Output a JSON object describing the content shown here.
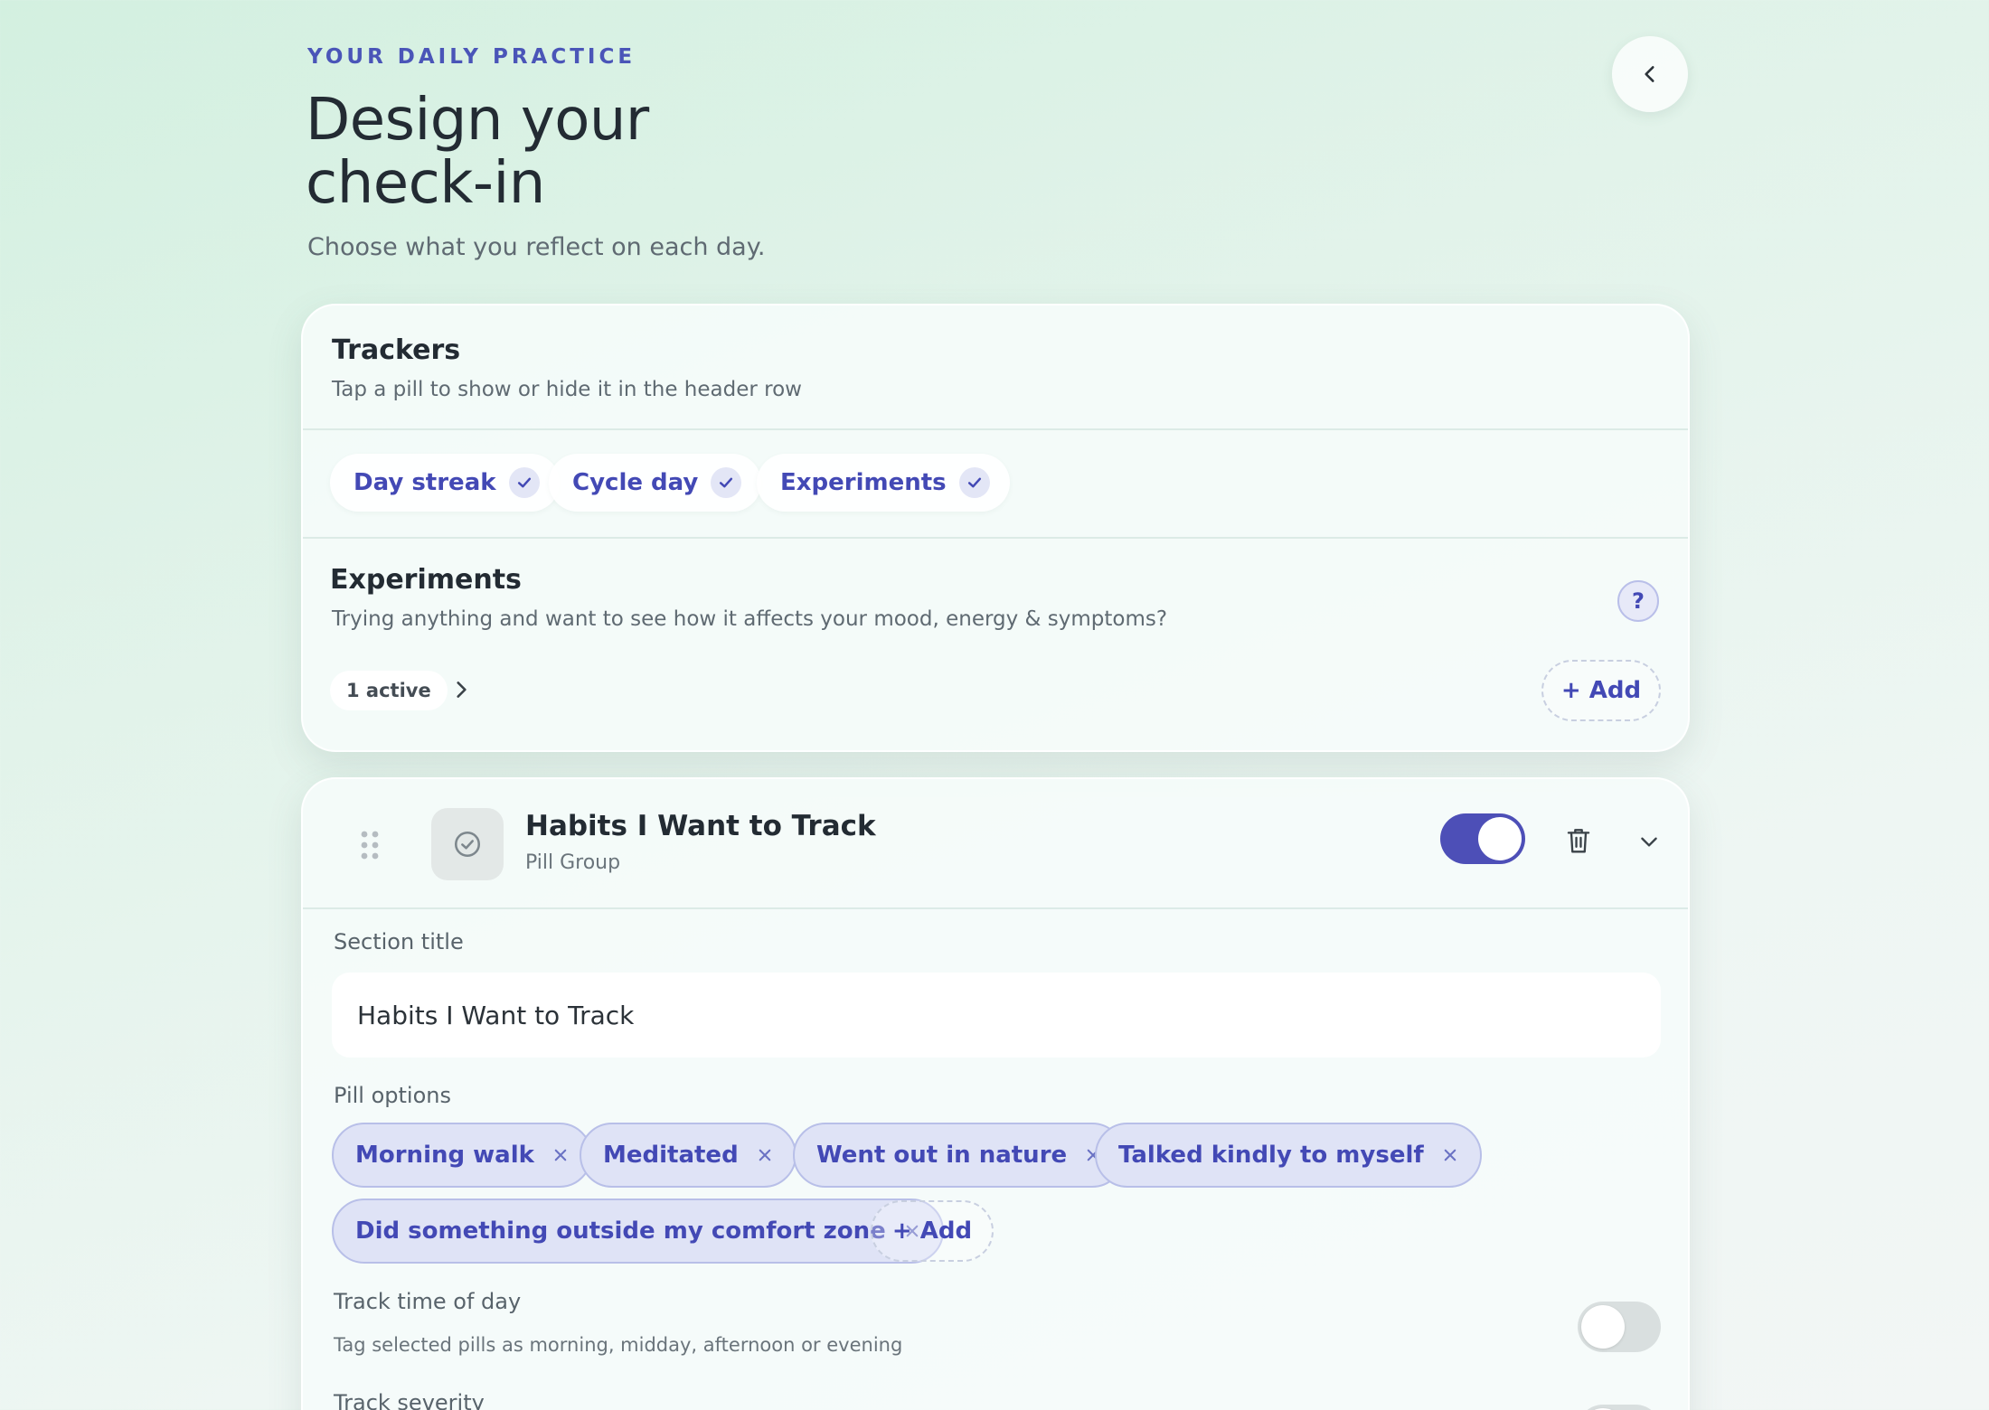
{
  "header": {
    "eyebrow": "YOUR DAILY PRACTICE",
    "title_line1": "Design your",
    "title_line2": "check-in",
    "subtitle": "Choose what you reflect on each day."
  },
  "trackers": {
    "title": "Trackers",
    "subtitle": "Tap a pill to show or hide it in the header row",
    "pills": [
      "Day streak",
      "Cycle day",
      "Experiments"
    ]
  },
  "experiments": {
    "title": "Experiments",
    "subtitle": "Trying anything and want to see how it affects your mood, energy & symptoms?",
    "help": "?",
    "active_label": "1 active",
    "add_label": "+ Add"
  },
  "habits": {
    "title": "Habits I Want to Track",
    "type": "Pill Group",
    "enabled": true,
    "section_title_label": "Section title",
    "section_title_value": "Habits I Want to Track",
    "pill_options_label": "Pill options",
    "options": [
      "Morning walk",
      "Meditated",
      "Went out in nature",
      "Talked kindly to myself",
      "Did something outside my comfort zone"
    ],
    "add_label": "+ Add",
    "time_of_day_label": "Track time of day",
    "time_of_day_desc": "Tag selected pills as morning, midday, afternoon or evening",
    "time_of_day_enabled": false,
    "severity_label": "Track severity",
    "severity_enabled": false
  },
  "colors": {
    "accent": "#4349b5",
    "toggle_on": "#4d4fb7",
    "pill_bg": "#dfe3f6"
  }
}
